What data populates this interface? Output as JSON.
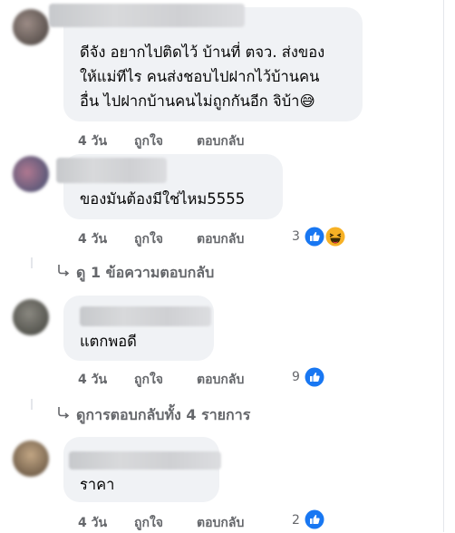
{
  "comments": [
    {
      "text_lines": [
        "ดีจัง อยากไปติดไว้ บ้านที่ ตจว. ส่งของ",
        "ให้แม่ทีไร คนส่งชอบไปฝากไว้บ้านคน",
        "อื่น ไปฝากบ้านคนไม่ถูกกันอีก จิบ้า"
      ],
      "emoji": "😅",
      "time": "4 วัน",
      "like_label": "ถูกใจ",
      "reply_label": "ตอบกลับ"
    },
    {
      "text": "ของมันต้องมีใช่ไหม5555",
      "time": "4 วัน",
      "like_label": "ถูกใจ",
      "reply_label": "ตอบกลับ",
      "reaction_count": "3",
      "reaction_emoji": "😝"
    },
    {
      "text": "แตกพอดี",
      "time": "4 วัน",
      "like_label": "ถูกใจ",
      "reply_label": "ตอบกลับ",
      "reaction_count": "9"
    },
    {
      "text": "ราคา",
      "time": "4 วัน",
      "like_label": "ถูกใจ",
      "reply_label": "ตอบกลับ",
      "reaction_count": "2"
    }
  ],
  "view_replies_1": "ดู 1 ข้อความตอบกลับ",
  "view_replies_2": "ดูการตอบกลับทั้ง 4 รายการ",
  "icons": {
    "like": "thumbs-up-icon",
    "haha": "laughing-emoji-icon",
    "reply_arrow": "reply-arrow-icon"
  },
  "colors": {
    "bubble": "#f0f2f5",
    "meta": "#65676b",
    "like_blue": "#1877f2"
  }
}
